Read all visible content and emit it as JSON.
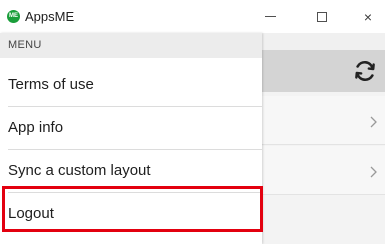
{
  "window": {
    "app_logo_text": "ME",
    "title": "AppsME",
    "controls": {
      "minimize": "minimize",
      "maximize": "maximize",
      "close": "×"
    }
  },
  "menu": {
    "header": "MENU",
    "items": [
      {
        "label": "Terms of use"
      },
      {
        "label": "App info"
      },
      {
        "label": "Sync a custom layout"
      },
      {
        "label": "Logout"
      }
    ],
    "highlighted_item": "Logout"
  },
  "background": {
    "icons": [
      "sync-icon",
      "chevron-right-icon",
      "chevron-right-icon"
    ]
  },
  "colors": {
    "brand": "#1a9e3a",
    "highlight": "#e3000f",
    "menu_header_bg": "#ececec",
    "sync_bar_bg": "#d4d4d4"
  }
}
